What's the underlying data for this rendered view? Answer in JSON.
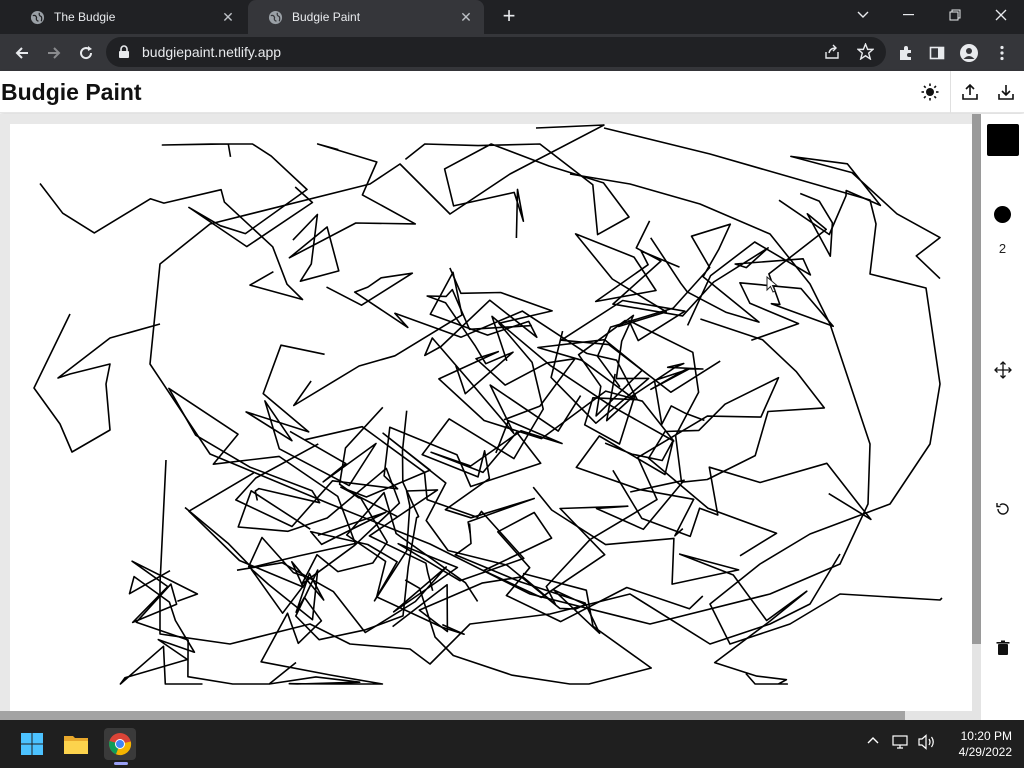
{
  "browser": {
    "tabs": [
      {
        "title": "The Budgie",
        "active": false
      },
      {
        "title": "Budgie Paint",
        "active": true
      }
    ],
    "url": "budgiepaint.netlify.app"
  },
  "app": {
    "title": "Budgie Paint",
    "theme_icon": "sun-icon",
    "brush": {
      "color": "#000000",
      "size": "2"
    }
  },
  "taskbar": {
    "time": "10:20 PM",
    "date": "4/29/2022"
  },
  "colors": {
    "chrome_dark": "#202124",
    "chrome_toolbar": "#35363a",
    "canvas_bg": "#ffffff",
    "stroke": "#000000"
  }
}
